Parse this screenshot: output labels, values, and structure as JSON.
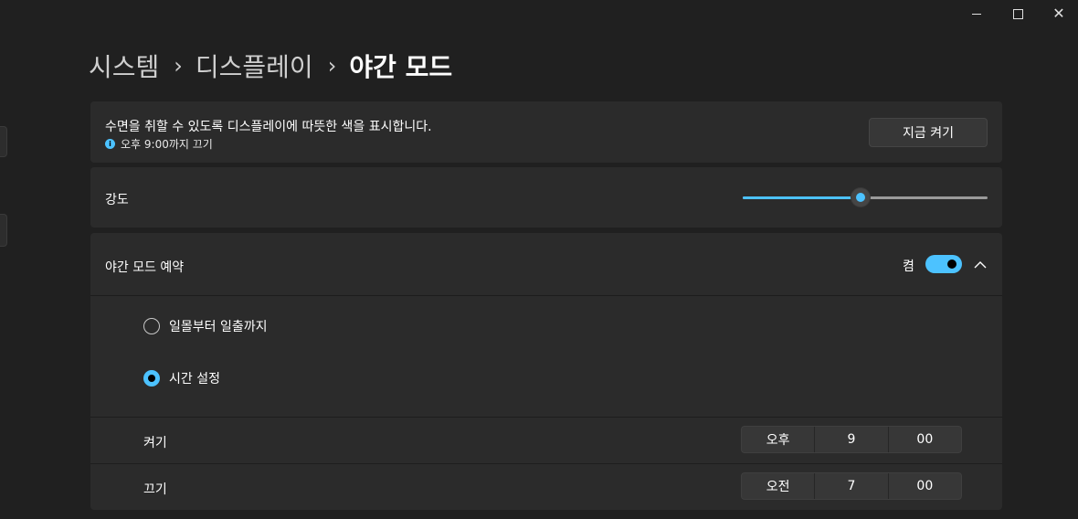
{
  "window": {
    "minimize_icon": "minimize-icon",
    "maximize_icon": "maximize-icon",
    "close_icon": "close-icon",
    "close_glyph": "✕"
  },
  "breadcrumb": {
    "items": [
      "시스템",
      "디스플레이",
      "야간 모드"
    ],
    "separator": "›"
  },
  "night_light": {
    "description": "수면을 취할 수 있도록 디스플레이에 따뜻한 색을 표시합니다.",
    "status": "오후 9:00까지 끄기",
    "status_icon": "info-icon",
    "button_label": "지금 켜기"
  },
  "strength": {
    "label": "강도",
    "value_percent": 48
  },
  "schedule": {
    "label": "야간 모드 예약",
    "toggle_state": "켬",
    "toggle_on": true,
    "expand_icon": "chevron-up-icon",
    "options": [
      {
        "label": "일몰부터 일출까지",
        "selected": false
      },
      {
        "label": "시간 설정",
        "selected": true
      }
    ],
    "turn_on": {
      "label": "켜기",
      "period": "오후",
      "hour": "9",
      "minute": "00"
    },
    "turn_off": {
      "label": "끄기",
      "period": "오전",
      "hour": "7",
      "minute": "00"
    }
  },
  "colors": {
    "accent": "#4cc2ff",
    "background": "#202020",
    "card": "#2b2b2b"
  }
}
